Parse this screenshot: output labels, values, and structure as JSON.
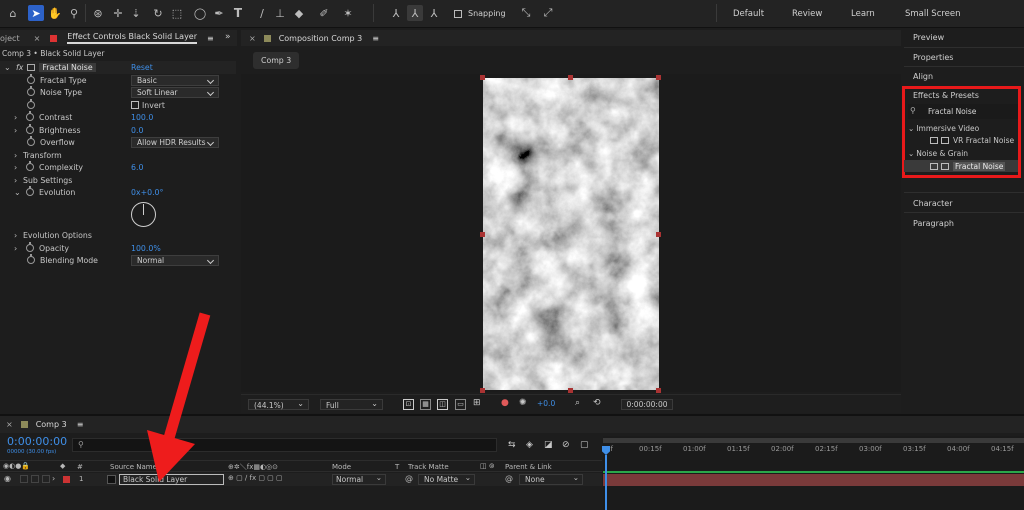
{
  "toolbar": {
    "snapping_label": "Snapping",
    "workspaces": [
      "Default",
      "Review",
      "Learn",
      "Small Screen"
    ]
  },
  "effect_controls": {
    "left_tab": "oject",
    "tab_title": "Effect Controls Black Solid Layer",
    "menu_glyph": "≡",
    "expand_glyph": "»",
    "layer_path": "Comp 3 • Black Solid Layer",
    "effect_name": "Fractal Noise",
    "reset_label": "Reset",
    "fractal_type": {
      "label": "Fractal Type",
      "value": "Basic"
    },
    "noise_type": {
      "label": "Noise Type",
      "value": "Soft Linear"
    },
    "invert_label": "Invert",
    "contrast": {
      "label": "Contrast",
      "value": "100.0"
    },
    "brightness": {
      "label": "Brightness",
      "value": "0.0"
    },
    "overflow": {
      "label": "Overflow",
      "value": "Allow HDR Results"
    },
    "transform_label": "Transform",
    "complexity": {
      "label": "Complexity",
      "value": "6.0"
    },
    "sub_settings_label": "Sub Settings",
    "evolution": {
      "label": "Evolution",
      "value": "0x+0.0°"
    },
    "evolution_options_label": "Evolution Options",
    "opacity": {
      "label": "Opacity",
      "value": "100.0%"
    },
    "blending_mode": {
      "label": "Blending Mode",
      "value": "Normal"
    }
  },
  "composition": {
    "tab_title": "Composition Comp 3",
    "menu_glyph": "≡",
    "breadcrumb": "Comp 3",
    "footer": {
      "zoom": "(44.1%)",
      "resolution": "Full",
      "exposure": "+0.0",
      "timecode": "0:00:00:00"
    }
  },
  "right_panel": {
    "items_top": [
      "Preview",
      "Properties",
      "Align"
    ],
    "effects_title": "Effects & Presets",
    "search_value": "Fractal Noise",
    "groups": [
      {
        "name": "Immersive Video",
        "item": "VR Fractal Noise"
      },
      {
        "name": "Noise & Grain",
        "item": "Fractal Noise"
      }
    ],
    "items_bottom": [
      "Character",
      "Paragraph"
    ],
    "highlight_color": "#e8191a"
  },
  "timeline": {
    "comp_tab": "Comp 3",
    "menu_glyph": "≡",
    "timecode": "0:00:00:00",
    "fps": "00000 (30.00 fps)",
    "col_num": "#",
    "col_source": "Source Name",
    "col_mode": "Mode",
    "col_t": "T",
    "col_track_matte": "Track Matte",
    "col_parent": "Parent & Link",
    "layer": {
      "index": "1",
      "name": "Black Solid Layer",
      "mode": "Normal",
      "matte": "No Matte",
      "parent": "None"
    },
    "ruler": [
      "0f",
      "00:15f",
      "01:00f",
      "01:15f",
      "02:00f",
      "02:15f",
      "03:00f",
      "03:15f",
      "04:00f",
      "04:15f"
    ]
  },
  "annotation": {
    "arrow_color": "#ee1c1c"
  }
}
